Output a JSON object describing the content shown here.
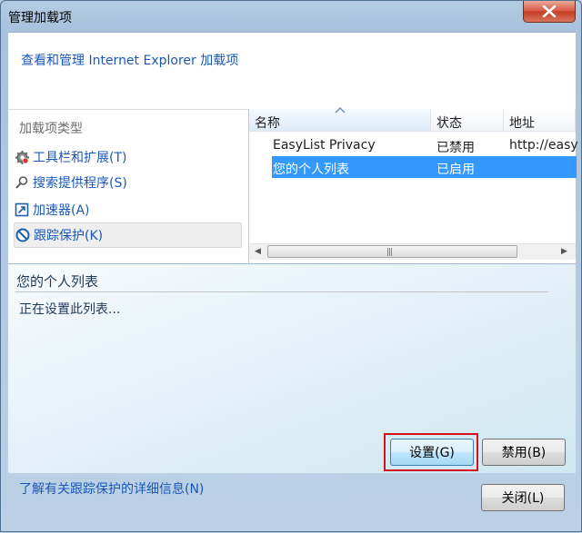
{
  "window": {
    "title": "管理加载项"
  },
  "header": {
    "text": "查看和管理 Internet Explorer 加载项"
  },
  "left_pane": {
    "heading": "加载项类型",
    "items": [
      {
        "label": "工具栏和扩展(T)",
        "icon": "gear-icon",
        "selected": false
      },
      {
        "label": "搜索提供程序(S)",
        "icon": "search-icon",
        "selected": false
      },
      {
        "label": "加速器(A)",
        "icon": "accelerator-icon",
        "selected": false
      },
      {
        "label": "跟踪保护(K)",
        "icon": "no-entry-icon",
        "selected": true
      }
    ]
  },
  "list": {
    "columns": [
      "名称",
      "状态",
      "地址"
    ],
    "sorted_column": "名称",
    "rows": [
      {
        "name": "EasyList Privacy",
        "status": "已禁用",
        "address": "http://easy",
        "selected": false
      },
      {
        "name": "您的个人列表",
        "status": "已启用",
        "address": "",
        "selected": true
      }
    ]
  },
  "detail": {
    "title": "您的个人列表",
    "status": "正在设置此列表..."
  },
  "buttons": {
    "settings": "设置(G)",
    "disable": "禁用(B)",
    "close": "关闭(L)"
  },
  "footer": {
    "link": "了解有关跟踪保护的详细信息(N)"
  },
  "colors": {
    "link": "#1a57b8",
    "selection": "#3399ff",
    "highlight_border": "#d2131b"
  }
}
